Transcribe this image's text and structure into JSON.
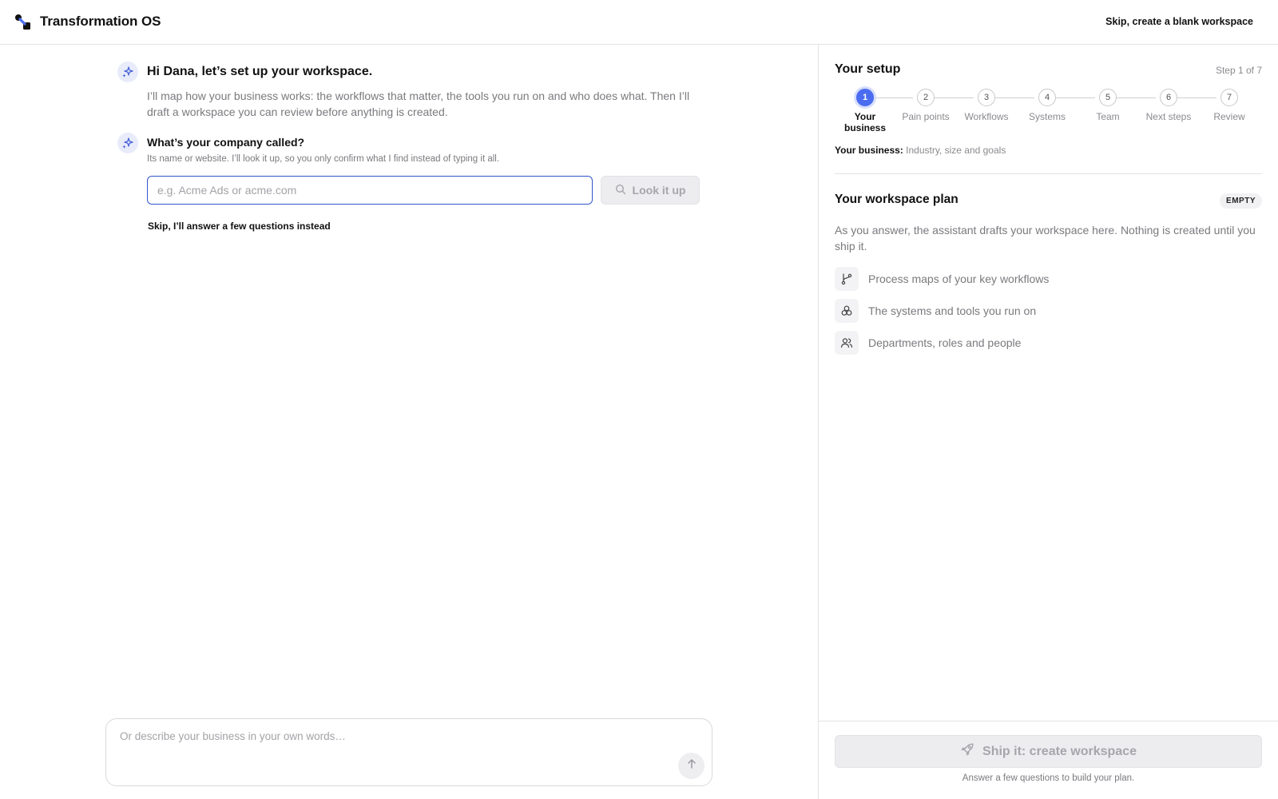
{
  "app": {
    "title": "Transformation OS",
    "skip_blank_label": "Skip, create a blank workspace",
    "logo_icon": "transformation-logo-icon"
  },
  "conversation": {
    "greeting_title": "Hi Dana, let’s set up your workspace.",
    "greeting_body": "I’ll map how your business works: the workflows that matter, the tools you run on and who does what. Then I’ll draft a workspace you can review before anything is created.",
    "question_title": "What’s your company called?",
    "question_hint": "Its name or website. I’ll look it up, so you only confirm what I find instead of typing it all.",
    "company_input": {
      "value": "",
      "placeholder": "e.g. Acme Ads or acme.com"
    },
    "lookup_label": "Look it up",
    "skip_questions_label": "Skip, I’ll answer a few questions instead",
    "composer": {
      "value": "",
      "placeholder": "Or describe your business in your own words…"
    },
    "assistant_icon": "sparkles-icon",
    "send_icon": "arrow-up-icon",
    "search_icon": "search-icon"
  },
  "setup": {
    "title": "Your setup",
    "step_count": "Step 1 of 7",
    "current_step": 1,
    "steps": [
      {
        "number": "1",
        "label": "Your business"
      },
      {
        "number": "2",
        "label": "Pain points"
      },
      {
        "number": "3",
        "label": "Workflows"
      },
      {
        "number": "4",
        "label": "Systems"
      },
      {
        "number": "5",
        "label": "Team"
      },
      {
        "number": "6",
        "label": "Next steps"
      },
      {
        "number": "7",
        "label": "Review"
      }
    ],
    "business_key": "Your business:",
    "business_value": "Industry, size and goals"
  },
  "plan": {
    "title": "Your workspace plan",
    "badge": "EMPTY",
    "description": "As you answer, the assistant drafts your workspace here. Nothing is created until you ship it.",
    "items": [
      {
        "icon": "git-branch-icon",
        "label": "Process maps of your key workflows"
      },
      {
        "icon": "systems-cluster-icon",
        "label": "The systems and tools you run on"
      },
      {
        "icon": "users-icon",
        "label": "Departments, roles and people"
      }
    ]
  },
  "footer": {
    "ship_label": "Ship it: create workspace",
    "ship_icon": "rocket-icon",
    "ship_hint": "Answer a few questions to build your plan."
  },
  "colors": {
    "accent": "#4a6cf0",
    "input_focus_border": "#2f55c9",
    "muted_text": "#7a7a7f",
    "disabled_button_bg": "#ededf0"
  }
}
